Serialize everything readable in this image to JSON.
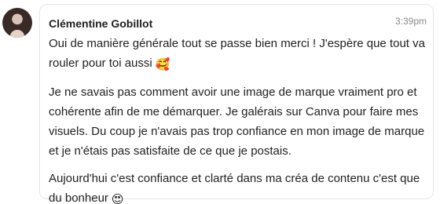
{
  "message": {
    "author": "Clémentine Gobillot",
    "time": "3:39pm",
    "paragraphs": [
      {
        "text": "Oui de manière générale tout se passe bien merci ! J'espère que tout va rouler pour toi aussi",
        "emoji": "🥰",
        "emoji_name": "smiling-face-with-hearts-icon"
      },
      {
        "text": "Je ne savais pas comment avoir une image de marque vraiment pro et cohérente afin de me démarquer. Je galérais sur Canva pour faire mes visuels. Du coup je n'avais pas trop confiance en mon image de marque et je n'étais pas satisfaite de ce que je postais."
      },
      {
        "text": "Aujourd'hui c'est confiance et clarté dans ma créa de contenu c'est que du bonheur",
        "emoji": "😍",
        "emoji_name": "heart-eyes-icon"
      }
    ]
  }
}
